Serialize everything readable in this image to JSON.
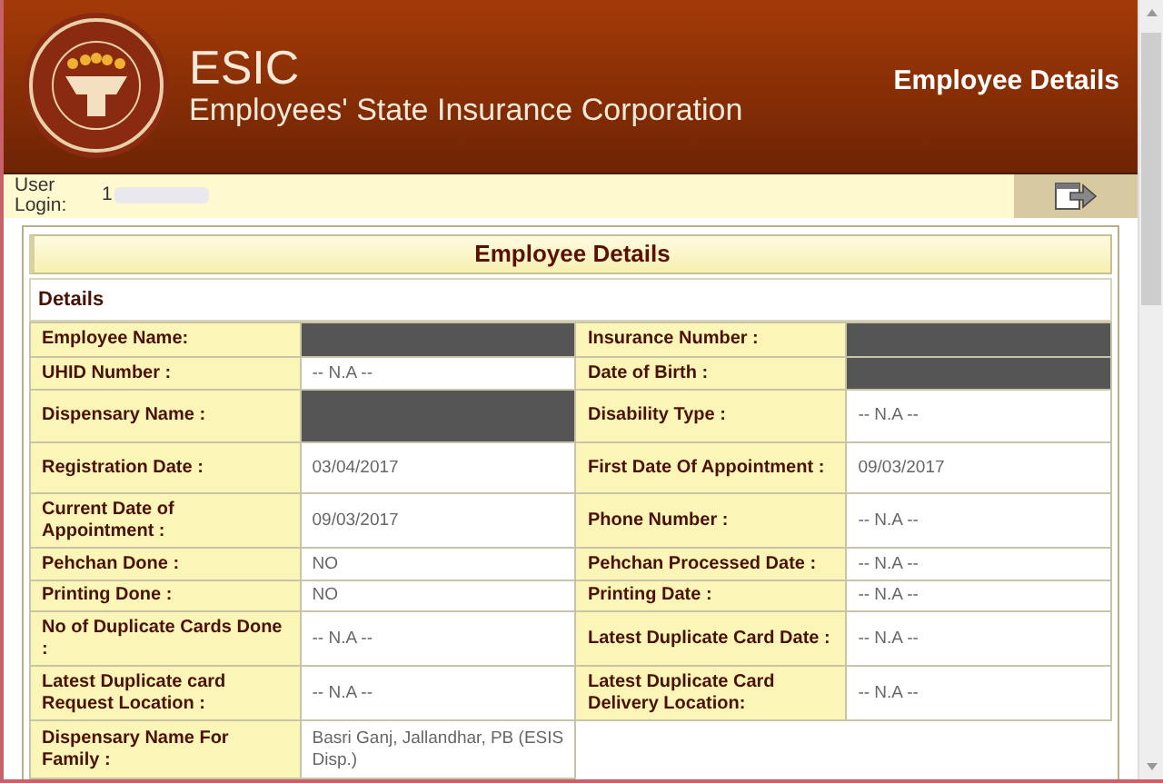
{
  "header": {
    "org_short": "ESIC",
    "org_full": "Employees' State Insurance Corporation",
    "page_title": "Employee Details"
  },
  "login": {
    "label": "User Login:",
    "value": "1",
    "redacted": true
  },
  "panel": {
    "title": "Employee Details",
    "section": "Details",
    "rows": [
      {
        "cells": [
          {
            "label": "Employee Name:",
            "redacted": true
          },
          {
            "label": "Insurance Number :",
            "redacted": true
          }
        ]
      },
      {
        "cells": [
          {
            "label": "UHID Number :",
            "value": "-- N.A --"
          },
          {
            "label": "Date of Birth :",
            "redacted": true
          }
        ]
      },
      {
        "cells": [
          {
            "label": "Dispensary Name :",
            "redacted": true
          },
          {
            "label": "Disability Type :",
            "value": "-- N.A --"
          }
        ]
      },
      {
        "cells": [
          {
            "label": "Registration Date :",
            "value": "03/04/2017"
          },
          {
            "label": "First Date Of Appointment :",
            "value": "09/03/2017"
          }
        ]
      },
      {
        "cells": [
          {
            "label": "Current Date of Appointment :",
            "value": "09/03/2017"
          },
          {
            "label": "Phone Number :",
            "value": "-- N.A --"
          }
        ]
      },
      {
        "cells": [
          {
            "label": "Pehchan Done :",
            "value": "NO"
          },
          {
            "label": "Pehchan Processed Date :",
            "value": "-- N.A --"
          }
        ]
      },
      {
        "cells": [
          {
            "label": "Printing Done :",
            "value": "NO"
          },
          {
            "label": "Printing Date :",
            "value": "-- N.A --"
          }
        ]
      },
      {
        "cells": [
          {
            "label": "No of Duplicate Cards Done :",
            "value": "-- N.A --"
          },
          {
            "label": "Latest Duplicate Card Date :",
            "value": "-- N.A --"
          }
        ]
      },
      {
        "cells": [
          {
            "label": "Latest Duplicate card Request Location :",
            "value": "-- N.A --"
          },
          {
            "label": "Latest Duplicate Card Delivery Location:",
            "value": "-- N.A --"
          }
        ]
      },
      {
        "cells": [
          {
            "label": "Dispensary Name For Family :",
            "value": "Basri Ganj, Jallandhar, PB (ESIS Disp.)"
          }
        ]
      }
    ]
  }
}
